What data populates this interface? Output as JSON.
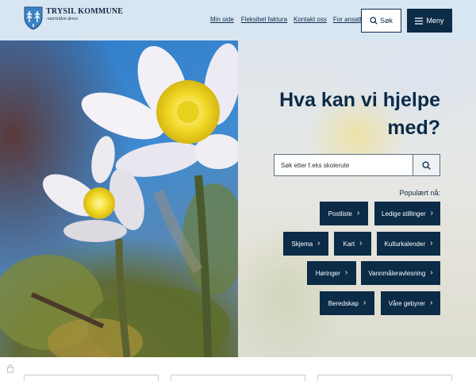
{
  "brand": {
    "name": "TRYSIL KOMMUNE",
    "tagline": "-startsiden deres",
    "shield_color": "#3b82c4",
    "primary_color": "#0b2b47"
  },
  "topnav": {
    "links": [
      "Min side",
      "Fleksibel faktura",
      "Kontakt oss",
      "For ansatte"
    ]
  },
  "header_buttons": {
    "search_label": "Søk",
    "menu_label": "Meny"
  },
  "hero": {
    "title": "Hva kan vi hjelpe med?",
    "search_placeholder": "Søk etter f.eks skolerute",
    "popular_label": "Populært nå:",
    "chips": [
      "Postliste",
      "Ledige stillinger",
      "Skjema",
      "Kart",
      "Kulturkalender",
      "Høringer",
      "Vannmåleravlesning",
      "Beredskap",
      "Våre gebyrer"
    ]
  }
}
